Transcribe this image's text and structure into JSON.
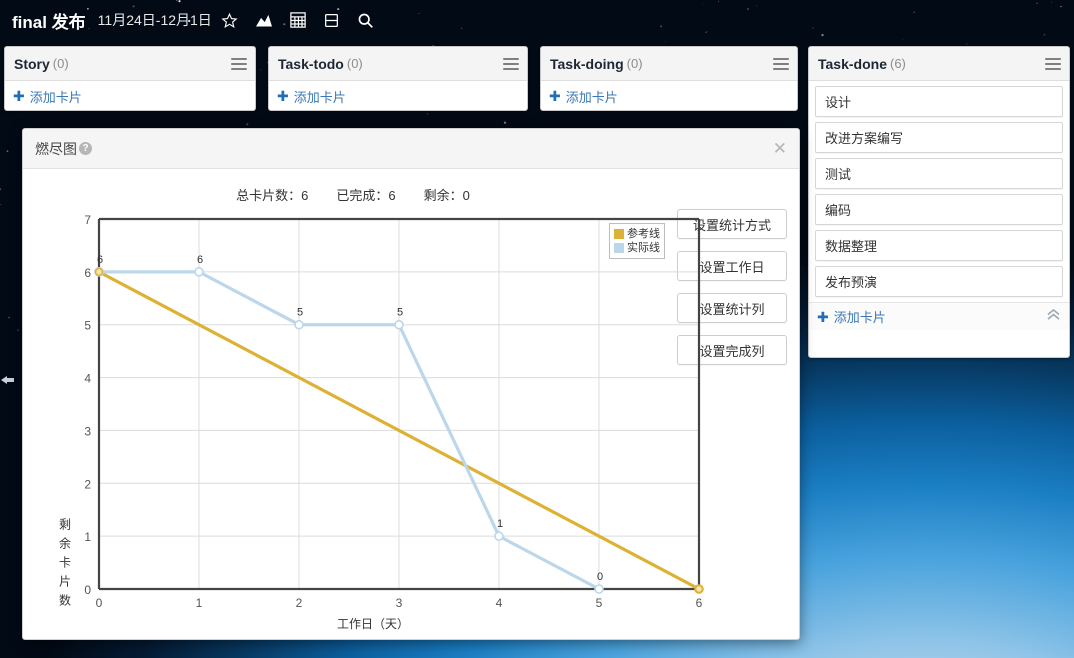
{
  "topbar": {
    "board_title": "final 发布",
    "date_range": "11月24日-12月1日",
    "icons": [
      {
        "name": "star-icon",
        "glyph": "☆"
      },
      {
        "name": "chart-icon",
        "glyph": "chart"
      },
      {
        "name": "grid-icon",
        "glyph": "grid"
      },
      {
        "name": "list-icon",
        "glyph": "list"
      },
      {
        "name": "search-icon",
        "glyph": "search"
      }
    ]
  },
  "board": {
    "add_card_label": "添加卡片",
    "columns": [
      {
        "name": "Story",
        "count": "(0)",
        "cards": []
      },
      {
        "name": "Task-todo",
        "count": "(0)",
        "cards": []
      },
      {
        "name": "Task-doing",
        "count": "(0)",
        "cards": []
      },
      {
        "name": "Task-done",
        "count": "(6)",
        "cards": [
          "设计",
          "改进方案编写",
          "测试",
          "编码",
          "数据整理",
          "发布预演"
        ]
      }
    ]
  },
  "dialog": {
    "title": "燃尽图",
    "help_glyph": "?",
    "close_glyph": "✕",
    "stats": [
      {
        "label": "总卡片数",
        "value": "6",
        "text": "总卡片数：6"
      },
      {
        "label": "已完成",
        "value": "6",
        "text": "已完成：6"
      },
      {
        "label": "剩余",
        "value": "0",
        "text": "剩余：0"
      }
    ],
    "buttons": [
      "设置统计方式",
      "设置工作日",
      "设置统计列",
      "设置完成列"
    ]
  },
  "chart_data": {
    "type": "line",
    "title": "燃尽图",
    "xlabel": "工作日（天）",
    "ylabel": "剩余卡片数",
    "xlim": [
      0,
      6
    ],
    "ylim": [
      0,
      7
    ],
    "xticks": [
      "0",
      "1",
      "2",
      "3",
      "4",
      "5",
      "6"
    ],
    "yticks": [
      "0",
      "1",
      "2",
      "3",
      "4",
      "5",
      "6",
      "7"
    ],
    "grid": true,
    "legend_position": "top-right",
    "series": [
      {
        "name": "参考线",
        "color": "#ddb133",
        "x": [
          0,
          6
        ],
        "values": [
          6,
          0
        ],
        "show_labels": false
      },
      {
        "name": "实际线",
        "color": "#bcd6ea",
        "x": [
          0,
          1,
          2,
          3,
          4,
          5
        ],
        "values": [
          6,
          6,
          5,
          5,
          1,
          0
        ],
        "labels": [
          "6",
          "6",
          "5",
          "5",
          "1",
          "0"
        ],
        "show_labels": true
      }
    ]
  },
  "colors": {
    "reference_line": "#ddb133",
    "actual_line": "#bcd6ea",
    "link": "#3a78b5",
    "axis": "#444444",
    "grid": "#dcdcdc"
  }
}
